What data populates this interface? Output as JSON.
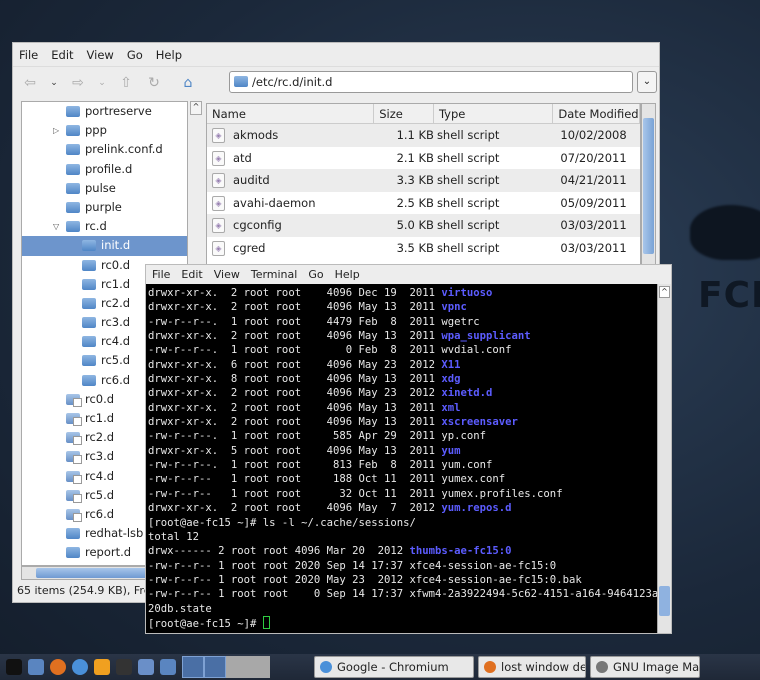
{
  "wallpaper": {
    "logo_text": "FCE"
  },
  "file_manager": {
    "menu": [
      "File",
      "Edit",
      "View",
      "Go",
      "Help"
    ],
    "toolbar_icons": [
      "back-icon",
      "chevron-down-icon",
      "forward-icon",
      "chevron-down-icon",
      "up-icon",
      "reload-icon",
      "home-icon"
    ],
    "location": "/etc/rc.d/init.d",
    "tree": [
      {
        "label": "portreserve",
        "level": 1
      },
      {
        "label": "ppp",
        "level": 1,
        "expander": "collapsed"
      },
      {
        "label": "prelink.conf.d",
        "level": 1
      },
      {
        "label": "profile.d",
        "level": 1
      },
      {
        "label": "pulse",
        "level": 1
      },
      {
        "label": "purple",
        "level": 1
      },
      {
        "label": "rc.d",
        "level": 1,
        "expander": "expanded"
      },
      {
        "label": "init.d",
        "level": 2,
        "selected": true
      },
      {
        "label": "rc0.d",
        "level": 2
      },
      {
        "label": "rc1.d",
        "level": 2
      },
      {
        "label": "rc2.d",
        "level": 2
      },
      {
        "label": "rc3.d",
        "level": 2
      },
      {
        "label": "rc4.d",
        "level": 2
      },
      {
        "label": "rc5.d",
        "level": 2
      },
      {
        "label": "rc6.d",
        "level": 2
      },
      {
        "label": "rc0.d",
        "level": 1,
        "link": true
      },
      {
        "label": "rc1.d",
        "level": 1,
        "link": true
      },
      {
        "label": "rc2.d",
        "level": 1,
        "link": true
      },
      {
        "label": "rc3.d",
        "level": 1,
        "link": true
      },
      {
        "label": "rc4.d",
        "level": 1,
        "link": true
      },
      {
        "label": "rc5.d",
        "level": 1,
        "link": true
      },
      {
        "label": "rc6.d",
        "level": 1,
        "link": true
      },
      {
        "label": "redhat-lsb",
        "level": 1
      },
      {
        "label": "report.d",
        "level": 1
      }
    ],
    "columns": [
      "Name",
      "Size",
      "Type",
      "Date Modified"
    ],
    "files": [
      {
        "name": "akmods",
        "size": "1.1 KB",
        "type": "shell script",
        "date": "10/02/2008"
      },
      {
        "name": "atd",
        "size": "2.1 KB",
        "type": "shell script",
        "date": "07/20/2011"
      },
      {
        "name": "auditd",
        "size": "3.3 KB",
        "type": "shell script",
        "date": "04/21/2011"
      },
      {
        "name": "avahi-daemon",
        "size": "2.5 KB",
        "type": "shell script",
        "date": "05/09/2011"
      },
      {
        "name": "cgconfig",
        "size": "5.0 KB",
        "type": "shell script",
        "date": "03/03/2011"
      },
      {
        "name": "cgred",
        "size": "3.5 KB",
        "type": "shell script",
        "date": "03/03/2011"
      }
    ],
    "status": "65 items (254.9 KB), Fre"
  },
  "terminal": {
    "menu": [
      "File",
      "Edit",
      "View",
      "Terminal",
      "Go",
      "Help"
    ],
    "lines": [
      [
        "drwxr-xr-x.  2 root root    4096 Dec 19  2011 ",
        "virtuoso"
      ],
      [
        "drwxr-xr-x.  2 root root    4096 May 13  2011 ",
        "vpnc"
      ],
      [
        "-rw-r--r--.  1 root root    4479 Feb  8  2011 wgetrc",
        ""
      ],
      [
        "drwxr-xr-x.  2 root root    4096 May 13  2011 ",
        "wpa_supplicant"
      ],
      [
        "-rw-r--r--.  1 root root       0 Feb  8  2011 wvdial.conf",
        ""
      ],
      [
        "drwxr-xr-x.  6 root root    4096 May 23  2012 ",
        "X11"
      ],
      [
        "drwxr-xr-x.  8 root root    4096 May 13  2011 ",
        "xdg"
      ],
      [
        "drwxr-xr-x.  2 root root    4096 May 23  2012 ",
        "xinetd.d"
      ],
      [
        "drwxr-xr-x.  2 root root    4096 May 13  2011 ",
        "xml"
      ],
      [
        "drwxr-xr-x.  2 root root    4096 May 13  2011 ",
        "xscreensaver"
      ],
      [
        "-rw-r--r--.  1 root root     585 Apr 29  2011 yp.conf",
        ""
      ],
      [
        "drwxr-xr-x.  5 root root    4096 May 13  2011 ",
        "yum"
      ],
      [
        "-rw-r--r--.  1 root root     813 Feb  8  2011 yum.conf",
        ""
      ],
      [
        "-rw-r--r--   1 root root     188 Oct 11  2011 yumex.conf",
        ""
      ],
      [
        "-rw-r--r--   1 root root      32 Oct 11  2011 yumex.profiles.conf",
        ""
      ],
      [
        "drwxr-xr-x.  2 root root    4096 May  7  2012 ",
        "yum.repos.d"
      ],
      [
        "[root@ae-fc15 ~]# ls -l ~/.cache/sessions/",
        ""
      ],
      [
        "total 12",
        ""
      ],
      [
        "drwx------ 2 root root 4096 Mar 20  2012 ",
        "thumbs-ae-fc15:0"
      ],
      [
        "-rw-r--r-- 1 root root 2020 Sep 14 17:37 xfce4-session-ae-fc15:0",
        ""
      ],
      [
        "-rw-r--r-- 1 root root 2020 May 23  2012 xfce4-session-ae-fc15:0.bak",
        ""
      ],
      [
        "-rw-r--r-- 1 root root    0 Sep 14 17:37 xfwm4-2a3922494-5c62-4151-a164-9464123a",
        ""
      ],
      [
        "20db.state",
        ""
      ]
    ],
    "prompt": "[root@ae-fc15 ~]# ",
    "colors": {
      "directory": "#5c5cff",
      "cursor": "#2ecc40"
    }
  },
  "taskbar": {
    "launchers": [
      "xfce-icon",
      "file-manager-icon",
      "firefox-icon",
      "chromium-icon",
      "search-icon",
      "terminal-icon",
      "calculator-icon",
      "home-icon"
    ],
    "tasks": [
      {
        "label": "Google - Chromium",
        "icon": "chromium-icon"
      },
      {
        "label": "lost window decoratio...",
        "icon": "firefox-icon"
      },
      {
        "label": "GNU Image Ma",
        "icon": "gimp-icon"
      }
    ]
  }
}
